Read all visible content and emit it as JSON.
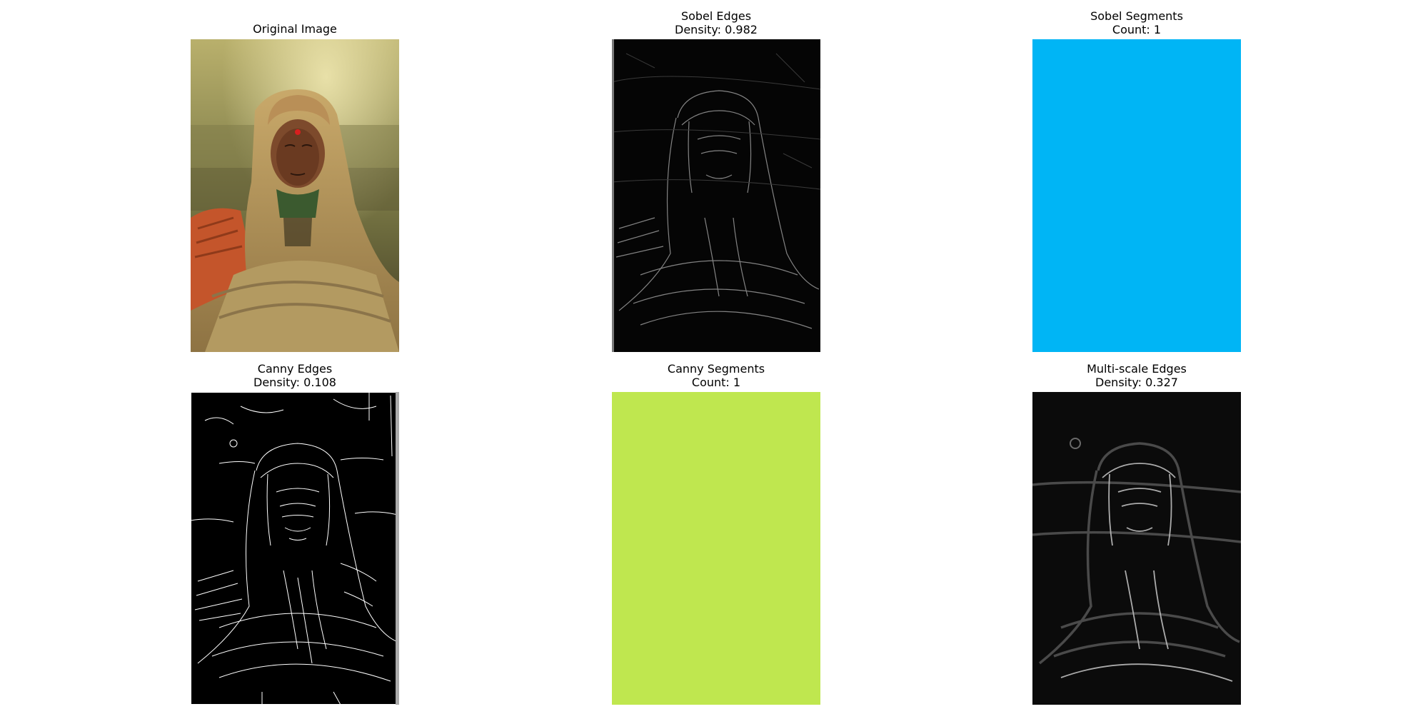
{
  "panels": [
    {
      "id": "original",
      "title_line1": "Original Image",
      "title_line2": "",
      "render": "photo"
    },
    {
      "id": "sobel-edges",
      "title_line1": "Sobel Edges",
      "title_line2": "Density: 0.982",
      "render": "edges-soft"
    },
    {
      "id": "sobel-segments",
      "title_line1": "Sobel Segments",
      "title_line2": "Count: 1",
      "render": "fill",
      "fill_color": "#00b5f5"
    },
    {
      "id": "canny-edges",
      "title_line1": "Canny Edges",
      "title_line2": "Density: 0.108",
      "render": "edges-binary"
    },
    {
      "id": "canny-segments",
      "title_line1": "Canny Segments",
      "title_line2": "Count: 1",
      "render": "fill",
      "fill_color": "#bfe74f"
    },
    {
      "id": "multiscale-edges",
      "title_line1": "Multi-scale Edges",
      "title_line2": "Density: 0.327",
      "render": "edges-blur"
    }
  ]
}
